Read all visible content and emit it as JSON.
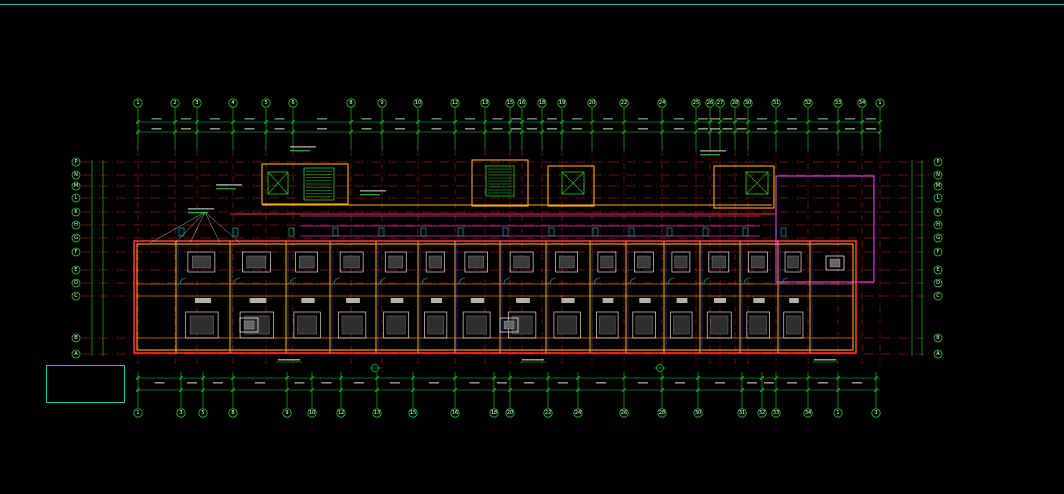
{
  "colors": {
    "background": "#000000",
    "axis_line": "#ff2020",
    "dimension": "#1fd01f",
    "wall_outer": "#ff3030",
    "wall_inner": "#ffae00",
    "fixtures": "#ffffff",
    "accent_cyan": "#19c3c3",
    "accent_magenta": "#ff40ff",
    "accent_blue": "#4040ff"
  },
  "axes": {
    "vertical_top": [
      "1",
      "2",
      "3",
      "4",
      "5",
      "6",
      "8",
      "9",
      "10",
      "12",
      "13",
      "15",
      "16",
      "18",
      "19",
      "20",
      "22",
      "24",
      "25",
      "26",
      "27",
      "28",
      "30",
      "31",
      "32",
      "33",
      "34"
    ],
    "vertical_bottom": [
      "1",
      "3",
      "5",
      "8",
      "9",
      "10",
      "12",
      "13",
      "15",
      "16",
      "18",
      "20",
      "22",
      "24",
      "26",
      "28",
      "30",
      "31",
      "32",
      "33",
      "34"
    ],
    "horizontal": [
      "P",
      "N",
      "M",
      "L",
      "K",
      "H",
      "G",
      "F",
      "E",
      "D",
      "C",
      "B",
      "A"
    ]
  },
  "legend": {
    "lines": [
      "",
      "",
      "",
      "",
      "",
      ""
    ]
  },
  "drawing": {
    "title": "",
    "subtitle": ""
  }
}
